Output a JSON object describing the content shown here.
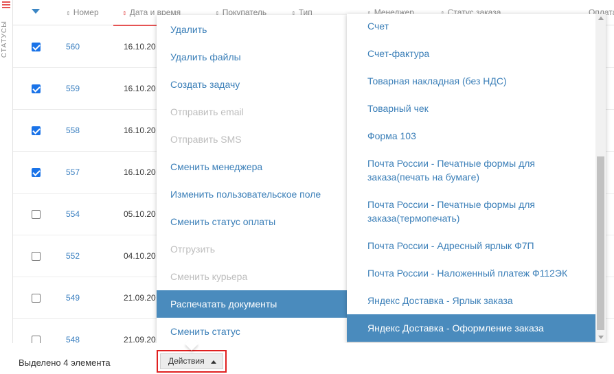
{
  "sidebar": {
    "status_label": "СТАТУСЫ"
  },
  "table": {
    "headers": {
      "number": "Номер",
      "date": "Дата и время",
      "buyer": "Покупатель",
      "type": "Тип",
      "manager": "Менеджер",
      "order_status": "Статус заказа",
      "payment": "Оплата"
    },
    "rows": [
      {
        "checked": true,
        "number": "560",
        "date": "16.10.20"
      },
      {
        "checked": true,
        "number": "559",
        "date": "16.10.20"
      },
      {
        "checked": true,
        "number": "558",
        "date": "16.10.20"
      },
      {
        "checked": true,
        "number": "557",
        "date": "16.10.20"
      },
      {
        "checked": false,
        "number": "554",
        "date": "05.10.20"
      },
      {
        "checked": false,
        "number": "552",
        "date": "04.10.20"
      },
      {
        "checked": false,
        "number": "549",
        "date": "21.09.20"
      },
      {
        "checked": false,
        "number": "548",
        "date": "21.09.20"
      }
    ]
  },
  "actions_menu": {
    "items": [
      {
        "label": "Удалить",
        "disabled": false
      },
      {
        "label": "Удалить файлы",
        "disabled": false
      },
      {
        "label": "Создать задачу",
        "disabled": false
      },
      {
        "label": "Отправить email",
        "disabled": true
      },
      {
        "label": "Отправить SMS",
        "disabled": true
      },
      {
        "label": "Сменить менеджера",
        "disabled": false
      },
      {
        "label": "Изменить пользовательское поле",
        "disabled": false
      },
      {
        "label": "Сменить статус оплаты",
        "disabled": false
      },
      {
        "label": "Отгрузить",
        "disabled": true
      },
      {
        "label": "Сменить курьера",
        "disabled": true
      },
      {
        "label": "Распечатать документы",
        "disabled": false,
        "active": true
      },
      {
        "label": "Сменить статус",
        "disabled": false
      }
    ]
  },
  "print_submenu": {
    "items": [
      {
        "label": "Счет"
      },
      {
        "label": "Счет-фактура"
      },
      {
        "label": "Товарная накладная (без НДС)"
      },
      {
        "label": "Товарный чек"
      },
      {
        "label": "Форма 103"
      },
      {
        "label": "Почта России - Печатные формы для заказа(печать на бумаге)"
      },
      {
        "label": "Почта России - Печатные формы для заказа(термопечать)"
      },
      {
        "label": "Почта России - Адресный ярлык Ф7П"
      },
      {
        "label": "Почта России - Наложенный платеж Ф112ЭК"
      },
      {
        "label": "Яндекс Доставка - Ярлык заказа"
      },
      {
        "label": "Яндекс Доставка - Оформление заказа",
        "active": true
      }
    ]
  },
  "footer": {
    "selected_count": "Выделено 4 элемента",
    "actions_label": "Действия"
  },
  "colors": {
    "link": "#3b7fb8",
    "active_bg": "#4a8bbd",
    "accent_red": "#e55353",
    "checkbox": "#1a73e8",
    "highlight_border": "#e02020"
  }
}
